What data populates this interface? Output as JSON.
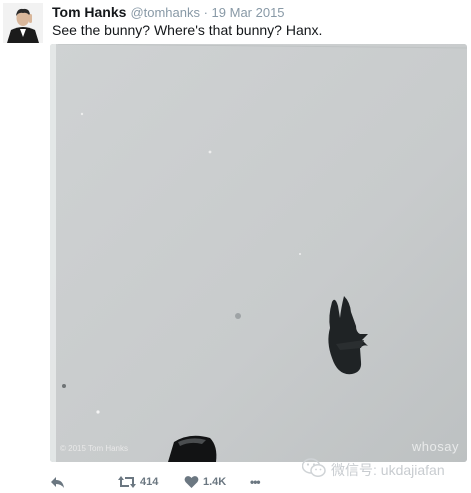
{
  "tweet": {
    "author_name": "Tom Hanks",
    "author_handle": "@tomhanks · 19 Mar 2015",
    "text": "See the bunny? Where's that bunny?  Hanx.",
    "photo_credit": "© 2015 Tom Hanks",
    "photo_watermark": "whosay"
  },
  "actions": {
    "reply_icon": "reply-icon",
    "retweet_icon": "retweet-icon",
    "retweet_count": "414",
    "like_icon": "heart-icon",
    "like_count": "1.4K",
    "more_icon": "more-icon",
    "more_label": "•••"
  },
  "watermark": {
    "icon": "wechat-icon",
    "text": "微信号: ukdajiafan"
  },
  "colors": {
    "pavement": "#c9cccd",
    "muted": "#8899a6"
  }
}
